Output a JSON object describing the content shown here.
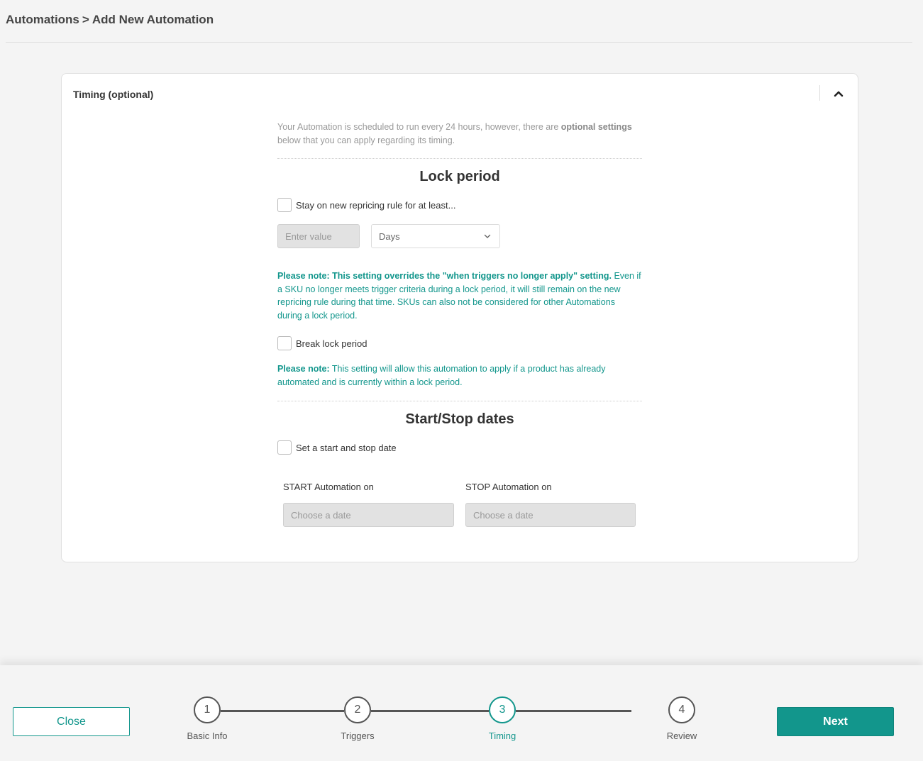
{
  "breadcrumb": {
    "parent": "Automations",
    "separator": ">",
    "current": "Add New Automation"
  },
  "panel": {
    "title": "Timing (optional)",
    "collapse_icon": "chevron-up-icon"
  },
  "intro": {
    "text_before": "Your Automation is scheduled to run every 24 hours, however, there are ",
    "bold": "optional settings",
    "text_after": " below that you can apply regarding its timing."
  },
  "lock_period": {
    "title": "Lock period",
    "stay_checkbox_label": "Stay on new repricing rule for at least...",
    "value_placeholder": "Enter value",
    "unit_selected": "Days",
    "note1_bold": "Please note: This setting overrides the \"when triggers no longer apply\" setting.",
    "note1_text": " Even if a SKU no longer meets trigger criteria during a lock period, it will still remain on the new repricing rule during that time. SKUs can also not be considered for other Automations during a lock period.",
    "break_checkbox_label": "Break lock period",
    "note2_bold": "Please note:",
    "note2_text": " This setting will allow this automation to apply if a product has already automated and is currently within a lock period."
  },
  "start_stop": {
    "title": "Start/Stop dates",
    "checkbox_label": "Set a start and stop date",
    "start_label": "START Automation on",
    "start_placeholder": "Choose a date",
    "stop_label": "STOP Automation on",
    "stop_placeholder": "Choose a date"
  },
  "footer": {
    "close_label": "Close",
    "next_label": "Next",
    "steps": [
      {
        "number": "1",
        "label": "Basic Info"
      },
      {
        "number": "2",
        "label": "Triggers"
      },
      {
        "number": "3",
        "label": "Timing"
      },
      {
        "number": "4",
        "label": "Review"
      }
    ],
    "active_step": 3
  },
  "colors": {
    "accent": "#12968c",
    "background": "#f4f4f4",
    "disabled_input": "#e2e2e2"
  }
}
